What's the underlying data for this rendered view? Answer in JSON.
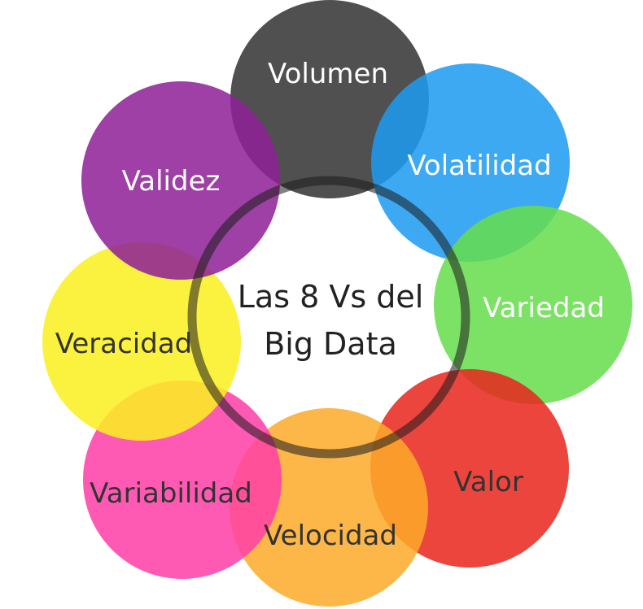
{
  "diagram": {
    "center_title_line1": "Las 8 Vs del",
    "center_title_line2": "Big Data",
    "ring_color": "#1a1a1a",
    "petals": [
      {
        "label": "Volumen",
        "color": "#333333",
        "text_color": "#ffffff"
      },
      {
        "label": "Volatilidad",
        "color": "#1d9bf0",
        "text_color": "#ffffff"
      },
      {
        "label": "Variedad",
        "color": "#66dd4d",
        "text_color": "#ffffff"
      },
      {
        "label": "Valor",
        "color": "#e8261e",
        "text_color": "#333333"
      },
      {
        "label": "Velocidad",
        "color": "#fdaa2a",
        "text_color": "#333333"
      },
      {
        "label": "Variabilidad",
        "color": "#ff3fa6",
        "text_color": "#333333"
      },
      {
        "label": "Veracidad",
        "color": "#faf020",
        "text_color": "#333333"
      },
      {
        "label": "Validez",
        "color": "#8e2196",
        "text_color": "#ffffff"
      }
    ]
  }
}
